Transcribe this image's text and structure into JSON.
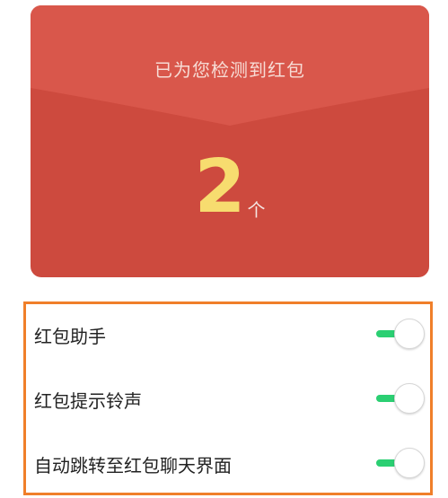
{
  "envelope": {
    "title": "已为您检测到红包",
    "count": "2",
    "unit": "个"
  },
  "settings": {
    "items": [
      {
        "label": "红包助手",
        "toggle_on": true
      },
      {
        "label": "红包提示铃声",
        "toggle_on": true
      },
      {
        "label": "自动跳转至红包聊天界面",
        "toggle_on": true
      }
    ]
  },
  "colors": {
    "envelope_bg": "#cd4a3e",
    "envelope_flap": "#d9574b",
    "count": "#f7dc6f",
    "frame": "#f07f2a",
    "toggle_on": "#2bcf72"
  }
}
